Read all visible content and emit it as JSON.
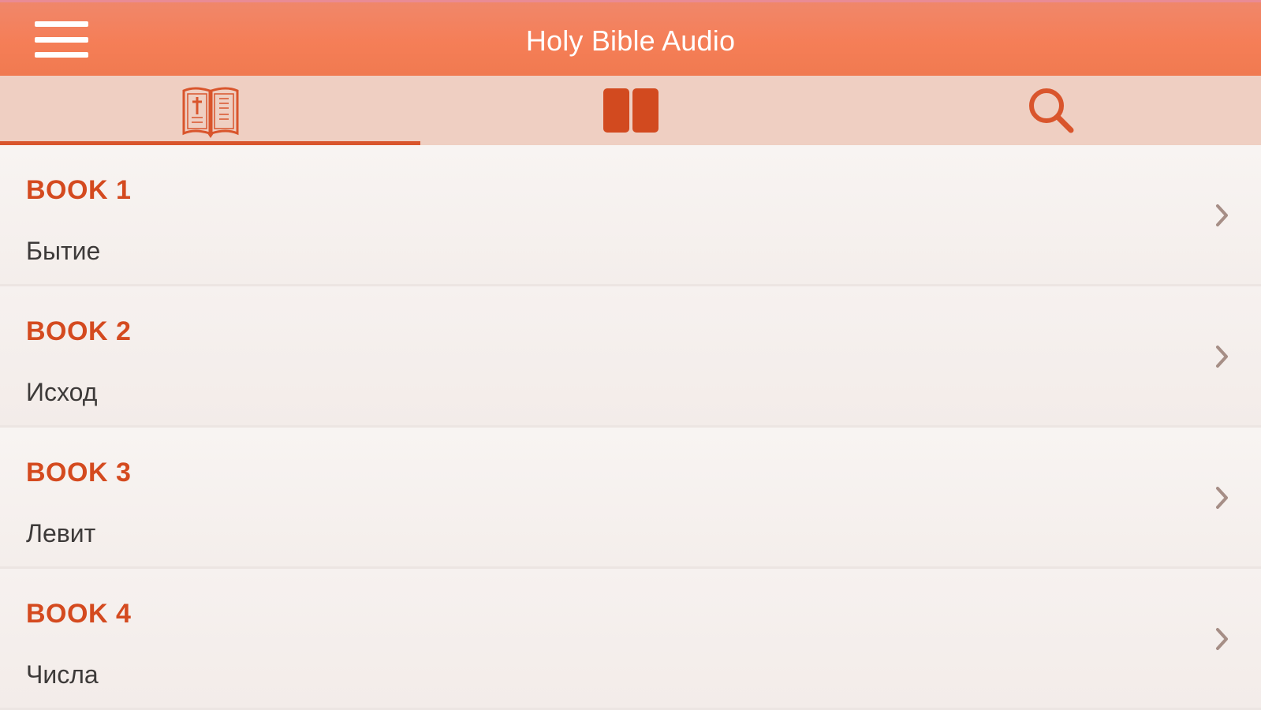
{
  "header": {
    "title": "Holy Bible Audio",
    "menu_icon": "hamburger-menu-icon"
  },
  "tabs": [
    {
      "id": "bible",
      "icon": "open-bible-icon",
      "active": true
    },
    {
      "id": "books",
      "icon": "book-icon",
      "active": false
    },
    {
      "id": "search",
      "icon": "search-icon",
      "active": false
    }
  ],
  "books": [
    {
      "label": "BOOK 1",
      "name": "Бытие"
    },
    {
      "label": "BOOK 2",
      "name": "Исход"
    },
    {
      "label": "BOOK 3",
      "name": "Левит"
    },
    {
      "label": "BOOK 4",
      "name": "Числа"
    }
  ],
  "colors": {
    "header": "#f57e57",
    "tabs_bg": "#efcfc2",
    "accent": "#d44a1f",
    "text": "#3d3a39"
  }
}
